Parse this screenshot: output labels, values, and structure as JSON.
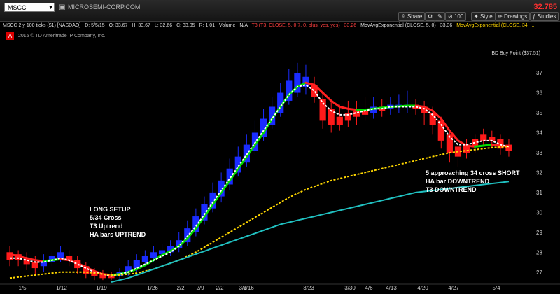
{
  "toolbar": {
    "symbol": "MSCC",
    "company": "MICROSEMI-CORP.COM",
    "last_price": "32.785",
    "buttons": {
      "share": "Share",
      "zoom": "100",
      "style": "Style",
      "drawings": "Drawings",
      "studies": "Studies"
    }
  },
  "studies": {
    "header": "MSCC 2 y 100 ticks ($1) [NASDAQ]",
    "d": "D: 5/5/15",
    "o": "O: 33.67",
    "h": "H: 33.67",
    "l": "L: 32.66",
    "c": "C: 33.05",
    "r": "R: 1.01",
    "volume": "Volume",
    "na": "N/A",
    "t3": "T3 (T3, CLOSE, 5, 0.7, 0, plus, yes, yes)",
    "t3_val": "33.26",
    "ema5": "MovAvgExponential (CLOSE, 5, 0)",
    "ema5_val": "33.36",
    "ema34": "MovAvgExponential (CLOSE, 34, ..."
  },
  "copyright": "2015 © TD Ameritrade IP Company, Inc.",
  "badge": "A",
  "buy_point": "IBD Buy Point ($37.51)",
  "annotations": {
    "long": [
      "LONG SETUP",
      "5/34 Cross",
      "T3 Uptrend",
      "HA bars UPTREND"
    ],
    "short": [
      "5 approaching 34 cross SHORT",
      "HA bar DOWNTREND",
      "T3 DOWNTREND"
    ]
  },
  "chart_data": {
    "type": "candlestick",
    "y_axis_labels": [
      "37",
      "36",
      "35",
      "34",
      "33",
      "32",
      "31",
      "30",
      "29",
      "28",
      "27"
    ],
    "x_axis_labels": [
      "1/5",
      "1/12",
      "1/19",
      "1/26",
      "2/2",
      "2/9",
      "2/2",
      "3/2",
      "3/16",
      "3/23",
      "3/30",
      "4/6",
      "4/13",
      "4/20",
      "4/27",
      "5/4"
    ],
    "ylim": [
      26.5,
      37.6
    ],
    "candles": [
      {
        "o": 27.6,
        "c": 28.0,
        "h": 28.3,
        "l": 27.3,
        "up": false
      },
      {
        "o": 27.9,
        "c": 27.6,
        "h": 28.1,
        "l": 27.3,
        "up": false
      },
      {
        "o": 27.7,
        "c": 27.4,
        "h": 28.0,
        "l": 27.1,
        "up": false
      },
      {
        "o": 27.5,
        "c": 27.2,
        "h": 27.8,
        "l": 26.9,
        "up": false
      },
      {
        "o": 27.3,
        "c": 27.6,
        "h": 27.9,
        "l": 27.0,
        "up": true
      },
      {
        "o": 27.5,
        "c": 27.8,
        "h": 28.0,
        "l": 27.3,
        "up": true
      },
      {
        "o": 27.7,
        "c": 28.0,
        "h": 28.3,
        "l": 27.5,
        "up": true
      },
      {
        "o": 27.8,
        "c": 27.6,
        "h": 28.1,
        "l": 27.3,
        "up": false
      },
      {
        "o": 27.6,
        "c": 27.2,
        "h": 27.8,
        "l": 26.9,
        "up": false
      },
      {
        "o": 27.3,
        "c": 26.9,
        "h": 27.5,
        "l": 26.7,
        "up": false
      },
      {
        "o": 27.0,
        "c": 26.8,
        "h": 27.2,
        "l": 26.6,
        "up": false
      },
      {
        "o": 26.9,
        "c": 26.7,
        "h": 27.1,
        "l": 26.6,
        "up": false
      },
      {
        "o": 26.8,
        "c": 26.7,
        "h": 27.0,
        "l": 26.6,
        "up": false
      },
      {
        "o": 26.8,
        "c": 27.0,
        "h": 27.2,
        "l": 26.6,
        "up": true
      },
      {
        "o": 27.0,
        "c": 27.3,
        "h": 27.6,
        "l": 26.8,
        "up": true
      },
      {
        "o": 27.2,
        "c": 27.6,
        "h": 27.9,
        "l": 27.0,
        "up": true
      },
      {
        "o": 27.5,
        "c": 27.8,
        "h": 28.1,
        "l": 27.3,
        "up": true
      },
      {
        "o": 27.7,
        "c": 28.0,
        "h": 28.3,
        "l": 27.5,
        "up": true
      },
      {
        "o": 27.9,
        "c": 28.1,
        "h": 28.4,
        "l": 27.6,
        "up": true
      },
      {
        "o": 28.0,
        "c": 28.3,
        "h": 28.6,
        "l": 27.8,
        "up": true
      },
      {
        "o": 28.2,
        "c": 28.6,
        "h": 29.0,
        "l": 28.0,
        "up": true
      },
      {
        "o": 28.5,
        "c": 29.2,
        "h": 29.6,
        "l": 28.3,
        "up": true
      },
      {
        "o": 29.0,
        "c": 29.8,
        "h": 30.2,
        "l": 28.8,
        "up": true
      },
      {
        "o": 29.6,
        "c": 30.4,
        "h": 30.8,
        "l": 29.4,
        "up": true
      },
      {
        "o": 30.2,
        "c": 31.0,
        "h": 31.5,
        "l": 30.0,
        "up": true
      },
      {
        "o": 30.8,
        "c": 31.6,
        "h": 32.0,
        "l": 30.5,
        "up": true
      },
      {
        "o": 31.4,
        "c": 32.2,
        "h": 32.7,
        "l": 31.1,
        "up": true
      },
      {
        "o": 32.0,
        "c": 32.8,
        "h": 33.3,
        "l": 31.8,
        "up": true
      },
      {
        "o": 32.5,
        "c": 33.4,
        "h": 33.9,
        "l": 32.3,
        "up": true
      },
      {
        "o": 33.1,
        "c": 34.0,
        "h": 34.6,
        "l": 32.9,
        "up": true
      },
      {
        "o": 33.8,
        "c": 34.7,
        "h": 35.2,
        "l": 33.6,
        "up": true
      },
      {
        "o": 34.4,
        "c": 35.3,
        "h": 35.8,
        "l": 34.2,
        "up": true
      },
      {
        "o": 35.0,
        "c": 36.0,
        "h": 36.5,
        "l": 34.8,
        "up": true
      },
      {
        "o": 35.6,
        "c": 36.6,
        "h": 37.2,
        "l": 35.4,
        "up": true
      },
      {
        "o": 36.0,
        "c": 37.0,
        "h": 37.5,
        "l": 35.8,
        "up": true
      },
      {
        "o": 36.3,
        "c": 36.8,
        "h": 37.4,
        "l": 35.9,
        "up": true
      },
      {
        "o": 36.4,
        "c": 35.8,
        "h": 36.8,
        "l": 35.5,
        "up": false
      },
      {
        "o": 35.7,
        "c": 34.6,
        "h": 36.0,
        "l": 34.2,
        "up": false
      },
      {
        "o": 35.2,
        "c": 34.4,
        "h": 35.6,
        "l": 34.0,
        "up": false
      },
      {
        "o": 34.8,
        "c": 34.4,
        "h": 35.4,
        "l": 34.1,
        "up": false
      },
      {
        "o": 34.6,
        "c": 35.0,
        "h": 35.6,
        "l": 34.3,
        "up": false
      },
      {
        "o": 34.8,
        "c": 35.1,
        "h": 35.6,
        "l": 34.4,
        "up": false
      },
      {
        "o": 34.9,
        "c": 35.2,
        "h": 35.8,
        "l": 34.6,
        "up": false
      },
      {
        "o": 35.0,
        "c": 35.3,
        "h": 35.8,
        "l": 34.7,
        "up": true
      },
      {
        "o": 35.1,
        "c": 35.3,
        "h": 35.7,
        "l": 34.8,
        "up": false
      },
      {
        "o": 35.2,
        "c": 35.4,
        "h": 35.8,
        "l": 34.9,
        "up": true
      },
      {
        "o": 35.3,
        "c": 35.4,
        "h": 35.9,
        "l": 35.0,
        "up": true
      },
      {
        "o": 35.3,
        "c": 35.4,
        "h": 36.1,
        "l": 35.0,
        "up": true
      },
      {
        "o": 35.4,
        "c": 35.2,
        "h": 35.7,
        "l": 34.9,
        "up": false
      },
      {
        "o": 35.3,
        "c": 35.0,
        "h": 35.6,
        "l": 34.4,
        "up": false
      },
      {
        "o": 35.0,
        "c": 34.4,
        "h": 35.3,
        "l": 33.9,
        "up": false
      },
      {
        "o": 34.6,
        "c": 33.6,
        "h": 34.8,
        "l": 33.2,
        "up": false
      },
      {
        "o": 33.9,
        "c": 33.0,
        "h": 34.1,
        "l": 32.5,
        "up": false
      },
      {
        "o": 33.3,
        "c": 32.8,
        "h": 33.5,
        "l": 32.3,
        "up": false
      },
      {
        "o": 33.0,
        "c": 33.4,
        "h": 33.7,
        "l": 32.7,
        "up": false
      },
      {
        "o": 33.3,
        "c": 33.7,
        "h": 33.9,
        "l": 33.0,
        "up": false
      },
      {
        "o": 33.6,
        "c": 33.9,
        "h": 34.2,
        "l": 33.3,
        "up": false
      },
      {
        "o": 33.8,
        "c": 33.6,
        "h": 34.1,
        "l": 33.2,
        "up": false
      },
      {
        "o": 33.7,
        "c": 33.2,
        "h": 33.9,
        "l": 32.9,
        "up": false
      },
      {
        "o": 33.4,
        "c": 33.1,
        "h": 33.7,
        "l": 32.8,
        "up": false
      }
    ],
    "series": [
      {
        "name": "T3",
        "color": "#00dd00",
        "color_alt": "#ff2020",
        "values": [
          27.9,
          27.8,
          27.7,
          27.6,
          27.55,
          27.6,
          27.65,
          27.6,
          27.45,
          27.25,
          27.05,
          26.9,
          26.85,
          26.9,
          27.0,
          27.15,
          27.35,
          27.6,
          27.85,
          28.05,
          28.3,
          28.7,
          29.2,
          29.8,
          30.4,
          31.0,
          31.6,
          32.2,
          32.8,
          33.4,
          34.0,
          34.7,
          35.3,
          35.9,
          36.3,
          36.5,
          36.4,
          36.0,
          35.6,
          35.3,
          35.2,
          35.15,
          35.15,
          35.2,
          35.25,
          35.3,
          35.32,
          35.35,
          35.35,
          35.3,
          35.1,
          34.7,
          34.1,
          33.6,
          33.35,
          33.3,
          33.35,
          33.4,
          33.35,
          33.3
        ]
      },
      {
        "name": "EMA5",
        "color": "#ffffff",
        "values": [
          27.7,
          27.7,
          27.6,
          27.5,
          27.5,
          27.6,
          27.7,
          27.6,
          27.4,
          27.2,
          27.0,
          26.9,
          26.8,
          26.9,
          27.0,
          27.2,
          27.4,
          27.6,
          27.8,
          28.0,
          28.3,
          28.8,
          29.3,
          29.9,
          30.5,
          31.1,
          31.7,
          32.3,
          32.9,
          33.5,
          34.1,
          34.7,
          35.3,
          35.9,
          36.3,
          36.4,
          36.1,
          35.5,
          35.1,
          34.9,
          34.9,
          35.0,
          35.1,
          35.2,
          35.2,
          35.3,
          35.3,
          35.3,
          35.3,
          35.2,
          34.9,
          34.4,
          33.8,
          33.4,
          33.4,
          33.5,
          33.6,
          33.6,
          33.4,
          33.3
        ]
      },
      {
        "name": "EMA34",
        "color": "#ffd700",
        "values": [
          26.7,
          26.75,
          26.8,
          26.85,
          26.9,
          26.95,
          27.0,
          27.0,
          27.0,
          27.0,
          26.95,
          26.9,
          26.85,
          26.85,
          26.9,
          26.95,
          27.05,
          27.15,
          27.3,
          27.45,
          27.6,
          27.8,
          28.0,
          28.25,
          28.5,
          28.75,
          29.0,
          29.25,
          29.5,
          29.75,
          30.0,
          30.25,
          30.5,
          30.75,
          30.95,
          31.15,
          31.3,
          31.45,
          31.6,
          31.7,
          31.8,
          31.9,
          32.0,
          32.1,
          32.2,
          32.3,
          32.4,
          32.5,
          32.6,
          32.7,
          32.8,
          32.9,
          33.0,
          33.05,
          33.1,
          33.15,
          33.2,
          33.25,
          33.28,
          33.3
        ]
      },
      {
        "name": "SMA",
        "color": "#20c0c0",
        "x_start": 12,
        "values": [
          26.5,
          26.6,
          26.7,
          26.85,
          27.0,
          27.15,
          27.3,
          27.45,
          27.6,
          27.75,
          27.9,
          28.05,
          28.2,
          28.35,
          28.5,
          28.65,
          28.8,
          28.95,
          29.1,
          29.25,
          29.4,
          29.5,
          29.6,
          29.7,
          29.8,
          29.9,
          30.0,
          30.1,
          30.2,
          30.3,
          30.4,
          30.5,
          30.6,
          30.7,
          30.8,
          30.9,
          31.0,
          31.05,
          31.1,
          31.15,
          31.2,
          31.25,
          31.3,
          31.35,
          31.4,
          31.45,
          31.5,
          31.55
        ]
      }
    ],
    "colors": {
      "up": "#1a2cff",
      "down": "#ff1a1a",
      "background": "#000000"
    }
  }
}
